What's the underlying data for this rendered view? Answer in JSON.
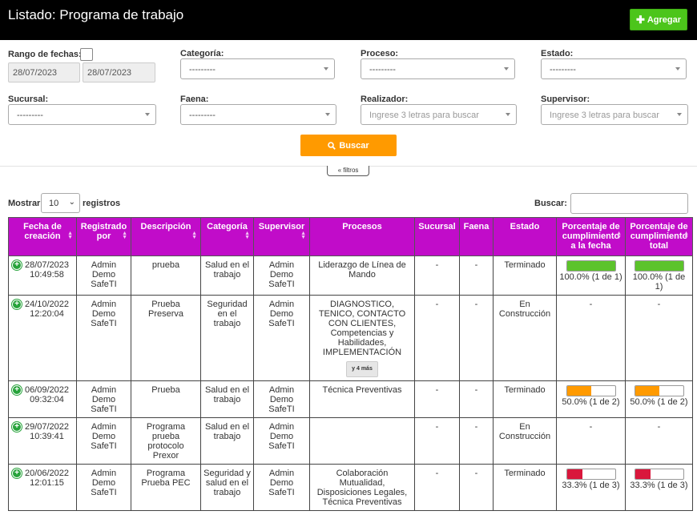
{
  "header": {
    "title": "Listado: Programa de trabajo",
    "add_label": "Agregar"
  },
  "filters": {
    "date_range_label": "Rango de fechas:",
    "date_from": "28/07/2023",
    "date_to": "28/07/2023",
    "categoria_label": "Categoría:",
    "categoria_value": "---------",
    "proceso_label": "Proceso:",
    "proceso_value": "---------",
    "estado_label": "Estado:",
    "estado_value": "---------",
    "sucursal_label": "Sucursal:",
    "sucursal_value": "---------",
    "faena_label": "Faena:",
    "faena_value": "---------",
    "realizador_label": "Realizador:",
    "realizador_placeholder": "Ingrese 3 letras para buscar",
    "supervisor_label": "Supervisor:",
    "supervisor_placeholder": "Ingrese 3 letras para buscar",
    "search_label": "Buscar",
    "toggle_label": "filtros"
  },
  "table_controls": {
    "show_label": "Mostrar",
    "page_length": "10",
    "records_label": "registros",
    "search_label": "Buscar:"
  },
  "columns": [
    "Fecha de creación",
    "Registrado por",
    "Descripción",
    "Categoría",
    "Supervisor",
    "Procesos",
    "Sucursal",
    "Faena",
    "Estado",
    "Porcentaje de cumplimiento a la fecha",
    "Porcentaje de cumplimiento total"
  ],
  "rows": [
    {
      "date": "28/07/2023",
      "time": "10:49:58",
      "registrado": "Admin Demo SafeTI",
      "descripcion": "prueba",
      "categoria": "Salud en el trabajo",
      "supervisor": "Admin Demo SafeTI",
      "procesos": "Liderazgo de Línea de Mando",
      "more": "",
      "sucursal": "-",
      "faena": "-",
      "estado": "Terminado",
      "pct_fecha": 100,
      "pct_fecha_text": "100.0% (1 de 1)",
      "pct_total": 100,
      "pct_total_text": "100.0% (1 de 1)",
      "color": "#5cc32b"
    },
    {
      "date": "24/10/2022",
      "time": "12:20:04",
      "registrado": "Admin Demo SafeTI",
      "descripcion": "Prueba Preserva",
      "categoria": "Seguridad en el trabajo",
      "supervisor": "Admin Demo SafeTI",
      "procesos": "DIAGNOSTICO, TENICO, CONTACTO CON CLIENTES, Competencias y Habilidades, IMPLEMENTACIÓN",
      "more": "y 4 más",
      "sucursal": "-",
      "faena": "-",
      "estado": "En Construcción",
      "pct_fecha": null,
      "pct_fecha_text": "-",
      "pct_total": null,
      "pct_total_text": "-",
      "color": ""
    },
    {
      "date": "06/09/2022",
      "time": "09:32:04",
      "registrado": "Admin Demo SafeTI",
      "descripcion": "Prueba",
      "categoria": "Salud en el trabajo",
      "supervisor": "Admin Demo SafeTI",
      "procesos": "Técnica Preventivas",
      "more": "",
      "sucursal": "-",
      "faena": "-",
      "estado": "Terminado",
      "pct_fecha": 50,
      "pct_fecha_text": "50.0% (1 de 2)",
      "pct_total": 50,
      "pct_total_text": "50.0% (1 de 2)",
      "color": "#ff9a00"
    },
    {
      "date": "29/07/2022",
      "time": "10:39:41",
      "registrado": "Admin Demo SafeTI",
      "descripcion": "Programa prueba protocolo Prexor",
      "categoria": "Salud en el trabajo",
      "supervisor": "Admin Demo SafeTI",
      "procesos": "",
      "more": "",
      "sucursal": "-",
      "faena": "-",
      "estado": "En Construcción",
      "pct_fecha": null,
      "pct_fecha_text": "-",
      "pct_total": null,
      "pct_total_text": "-",
      "color": ""
    },
    {
      "date": "20/06/2022",
      "time": "12:01:15",
      "registrado": "Admin Demo SafeTI",
      "descripcion": "Programa Prueba PEC",
      "categoria": "Seguridad y salud en el trabajo",
      "supervisor": "Admin Demo SafeTI",
      "procesos": "Colaboración Mutualidad, Disposiciones Legales, Técnica Preventivas",
      "more": "",
      "sucursal": "-",
      "faena": "-",
      "estado": "Terminado",
      "pct_fecha": 33.3,
      "pct_fecha_text": "33.3% (1 de 3)",
      "pct_total": 33.3,
      "pct_total_text": "33.3% (1 de 3)",
      "color": "#d9173c"
    }
  ]
}
